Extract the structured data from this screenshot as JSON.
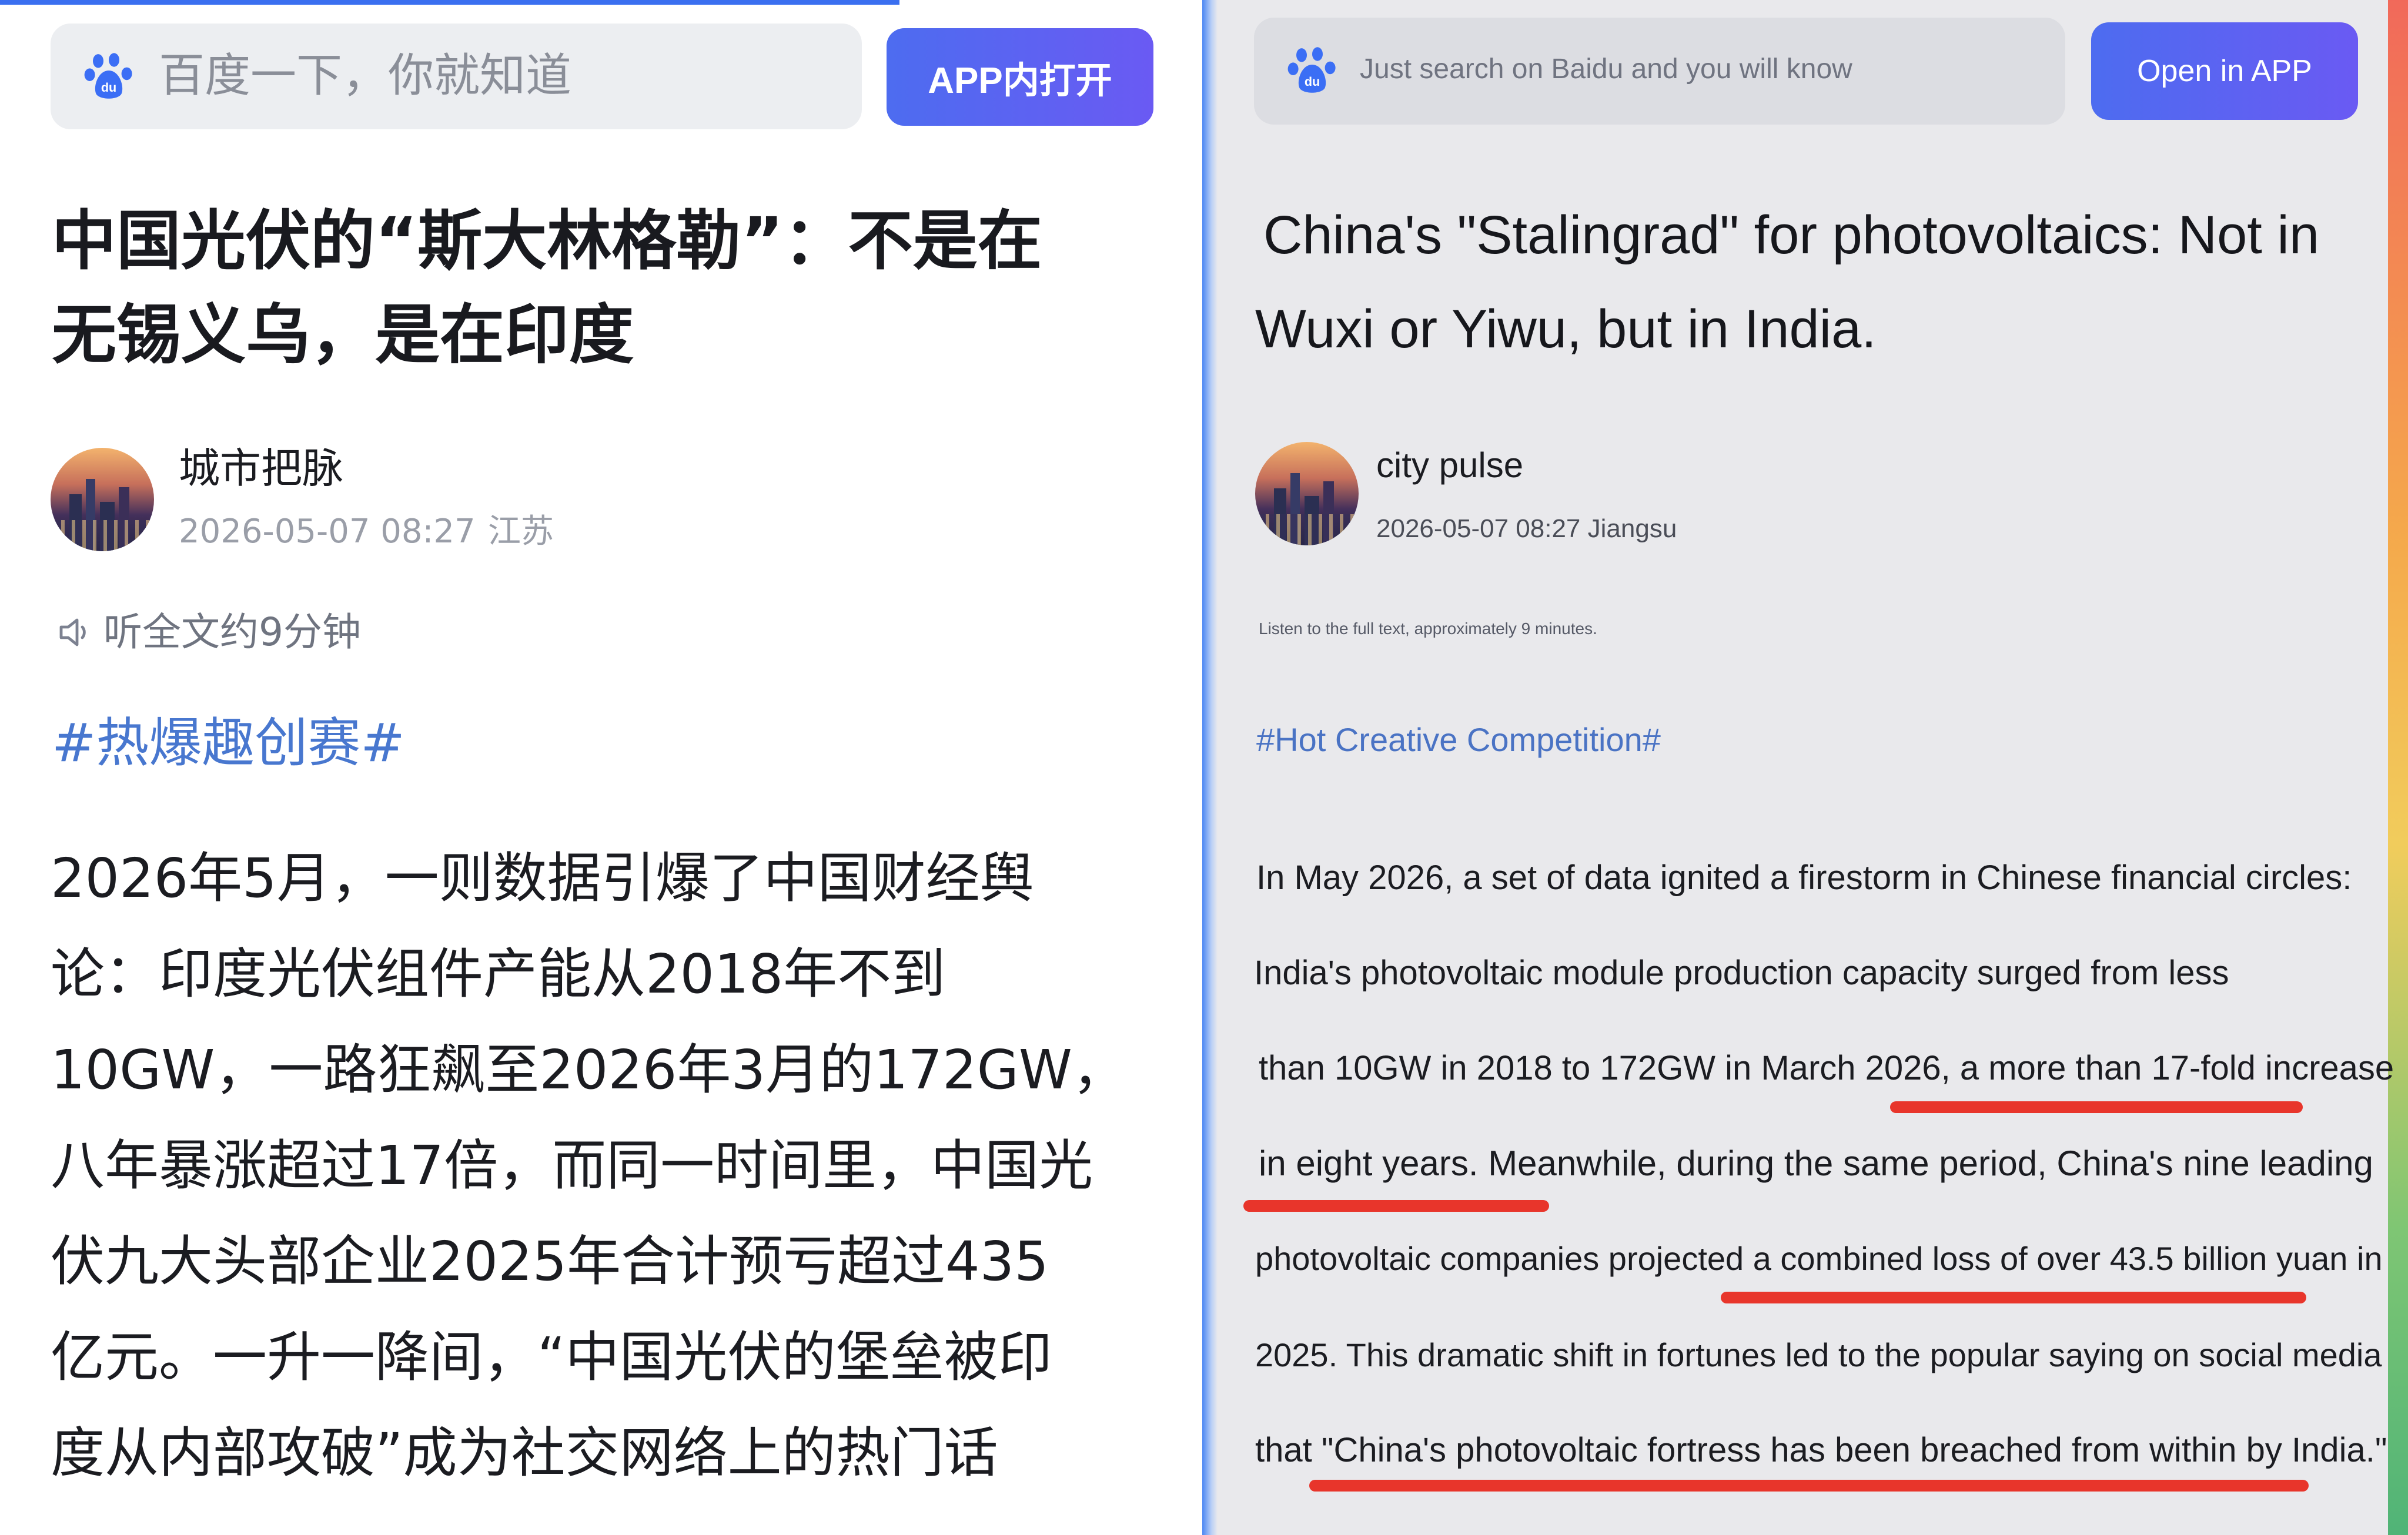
{
  "left": {
    "search": {
      "placeholder": "百度一下，你就知道"
    },
    "open_button": "APP内打开",
    "title_line1": "中国光伏的“斯大林格勒”：不是在",
    "title_line2": "无锡义乌，是在印度",
    "author": {
      "name": "城市把脉",
      "date": "2026-05-07 08:27",
      "location": "江苏"
    },
    "listen": "听全文约9分钟",
    "hashtag": "#热爆趣创赛#",
    "paragraph_lines": [
      "2026年5月，一则数据引爆了中国财经舆",
      "论：印度光伏组件产能从2018年不到",
      "10GW，一路狂飙至2026年3月的172GW，",
      "八年暴涨超过17倍，而同一时间里，中国光",
      "伏九大头部企业2025年合计预亏超过435",
      "亿元。一升一降间，“中国光伏的堡垒被印",
      "度从内部攻破”成为社交网络上的热门话"
    ]
  },
  "right": {
    "search": {
      "placeholder": "Just search on Baidu and you will know"
    },
    "open_button": "Open in APP",
    "title_line1": "China's \"Stalingrad\" for photovoltaics: Not in",
    "title_line2": "Wuxi or Yiwu, but in India.",
    "author": {
      "name": "city pulse",
      "meta": "2026-05-07 08:27 Jiangsu"
    },
    "listen": "Listen to the full text, approximately 9 minutes.",
    "hashtag": "#Hot Creative Competition#",
    "paragraph_lines": [
      "In May 2026, a set of data ignited a firestorm in Chinese financial circles:",
      "India's photovoltaic module production capacity surged from less",
      "than 10GW in 2018 to 172GW in March 2026, a more than 17-fold increase",
      "in eight years. Meanwhile, during the same period, China's nine leading",
      "photovoltaic companies projected a combined loss of over 43.5 billion yuan in",
      "2025. This dramatic shift in fortunes led to the popular saying on social media",
      "that \"China's photovoltaic fortress has been breached from within by India.\""
    ]
  },
  "colors": {
    "accent": "#4d6cf0",
    "hashtag": "#4877cf",
    "underline": "#e8352b",
    "progress": "#3a6ff0"
  },
  "icons": [
    "baidu-paw-icon",
    "speaker-icon"
  ]
}
